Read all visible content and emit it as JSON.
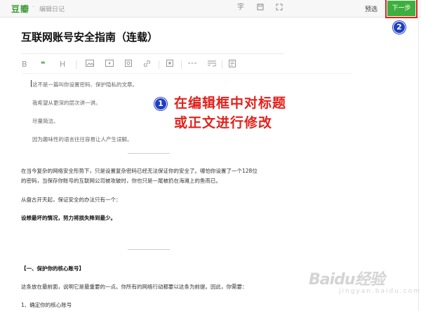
{
  "app": {
    "logo": "豆瓣",
    "separator": "·",
    "breadcrumb": "编辑日记"
  },
  "toolbar_top": {
    "font_icon": "字",
    "save_icon": "save-icon",
    "fullscreen_icon": "fullscreen-icon",
    "preview_label": "预选",
    "next_label": "下一步"
  },
  "badges": {
    "one": "1",
    "two": "2"
  },
  "document": {
    "title": "互联网账号安全指南（连载）",
    "format_icons": [
      "bold-icon",
      "quote-icon",
      "heading-icon",
      "image-icon",
      "video-icon",
      "embed-icon",
      "star-icon",
      "link-icon",
      "divider-icon",
      "wrap-icon",
      "note-icon"
    ],
    "format_glyphs": {
      "bold": "B",
      "quote": "❝",
      "heading": "H"
    },
    "quotes": [
      "这不是一篇叫你设置密码、保护隐私的文章。",
      "我希望从更深的层次讲一讲。",
      "尽量简洁。",
      "因为趣味性的语言往往容易让人产生误解。"
    ],
    "paragraphs": [
      "在当今复杂的网络安全形势下，只是设置复杂密码已经无法保证你的安全了。哪怕你设置了一个128位",
      "的密码，当保存你账号的互联网公司被攻破时，你也只是一尾被扔在海滩上的鱼而已。",
      "从盘古开天起，保证安全的办法只有一个：",
      "设想最坏的情况，努力将损失降到最少。",
      "【一、保护你的核心账号】",
      "这条放在最前面，说明它是最重要的一点。你所有的网络行动都要以这条为前提。因此，你需要：",
      "1、确定你的核心账号"
    ]
  },
  "annotation": {
    "line1": "在编辑框中对标题",
    "line2": "或正文进行修改"
  },
  "watermark": {
    "main": "Baidu经验",
    "sub": "jingyan.baidu.com"
  },
  "colors": {
    "brand_green": "#3eaf3e",
    "annotation_red": "#e3211c",
    "badge_blue": "#1f3fbf"
  }
}
